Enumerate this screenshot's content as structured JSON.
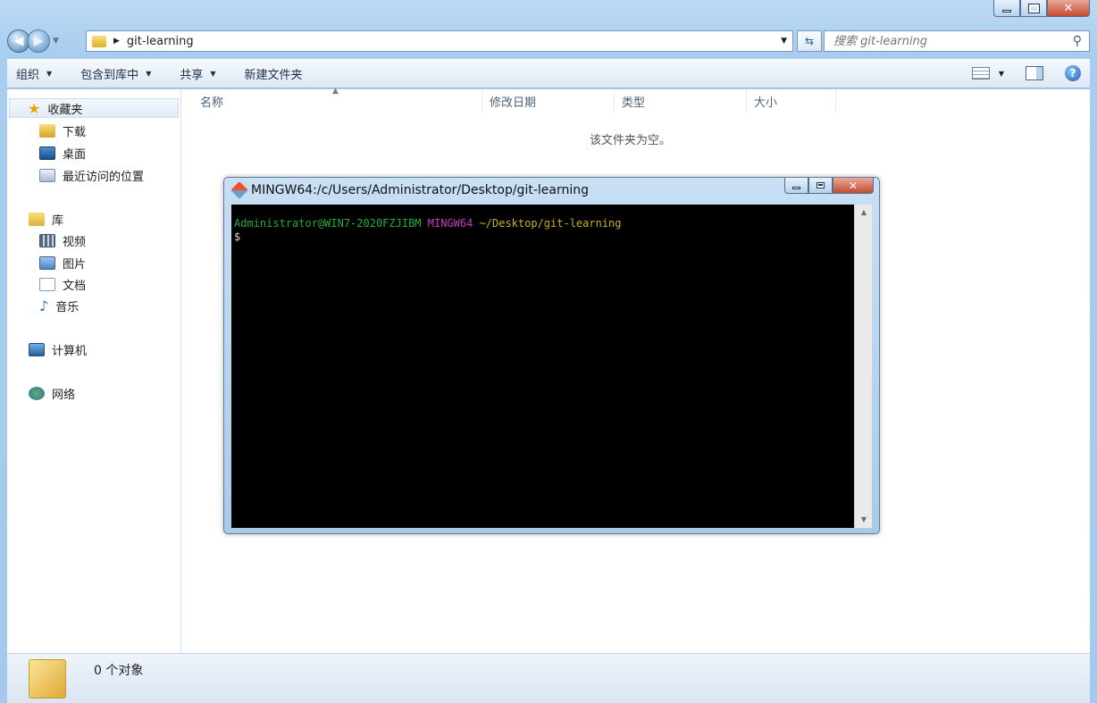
{
  "explorer": {
    "address": {
      "path": "git-learning"
    },
    "search": {
      "placeholder": "搜索 git-learning"
    },
    "toolbar": {
      "organize": "组织",
      "include_in_library": "包含到库中",
      "share": "共享",
      "new_folder": "新建文件夹"
    },
    "nav": {
      "favorites": "收藏夹",
      "downloads": "下载",
      "desktop": "桌面",
      "recent": "最近访问的位置",
      "libraries": "库",
      "videos": "视频",
      "pictures": "图片",
      "documents": "文档",
      "music": "音乐",
      "computer": "计算机",
      "network": "网络"
    },
    "columns": {
      "name": "名称",
      "date_modified": "修改日期",
      "type": "类型",
      "size": "大小"
    },
    "empty_message": "该文件夹为空。",
    "status": "0 个对象"
  },
  "terminal": {
    "title": "MINGW64:/c/Users/Administrator/Desktop/git-learning",
    "prompt_user": "Administrator@WIN7-2020FZJIBM",
    "prompt_env": "MINGW64",
    "prompt_path": "~/Desktop/git-learning",
    "prompt_symbol": "$"
  },
  "colors": {
    "terminal_user": "#1fae3a",
    "terminal_env": "#c43bc0",
    "terminal_path": "#c4b21c"
  }
}
